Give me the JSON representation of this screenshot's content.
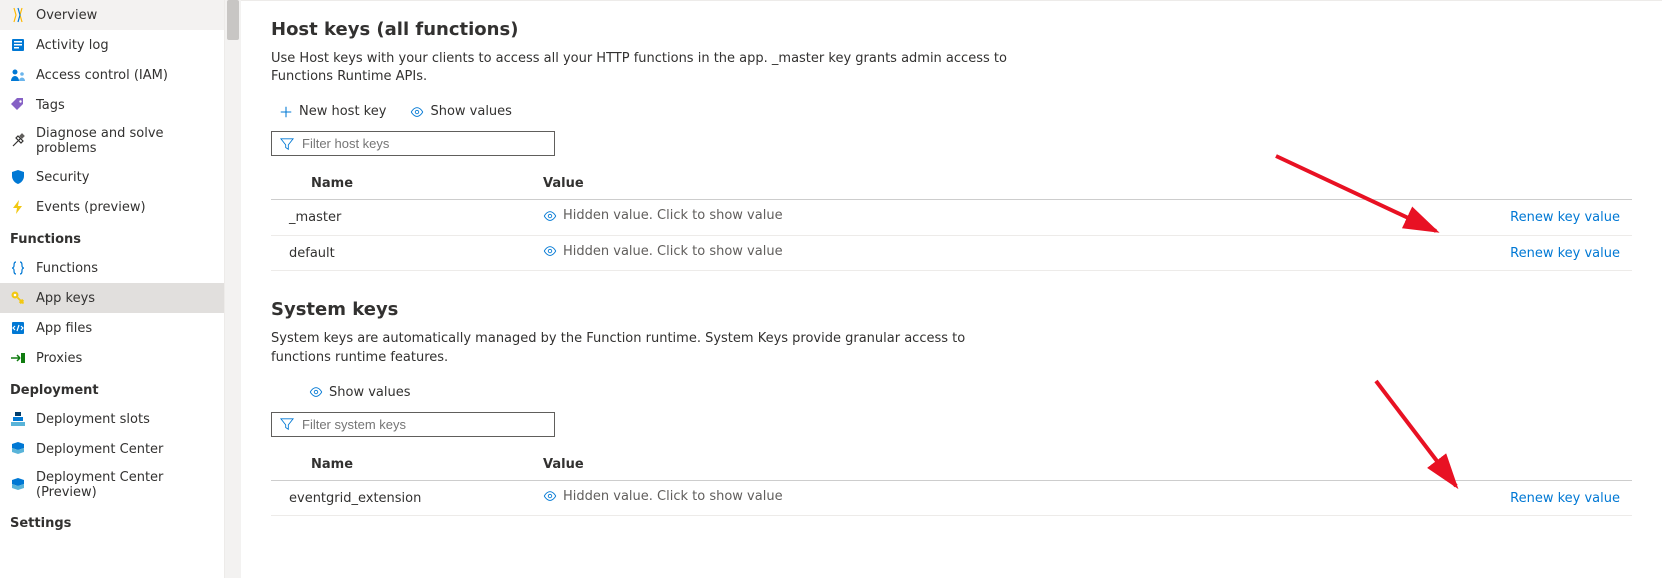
{
  "sidebar": {
    "topItems": [
      {
        "label": "Overview",
        "icon": "overview-icon",
        "color": "#0078d4"
      },
      {
        "label": "Activity log",
        "icon": "activity-log-icon",
        "color": "#0078d4"
      },
      {
        "label": "Access control (IAM)",
        "icon": "access-control-icon",
        "color": "#0078d4"
      },
      {
        "label": "Tags",
        "icon": "tags-icon",
        "color": "#6a2fc7"
      },
      {
        "label": "Diagnose and solve problems",
        "icon": "diagnose-icon",
        "color": "#323130"
      },
      {
        "label": "Security",
        "icon": "security-icon",
        "color": "#0078d4"
      },
      {
        "label": "Events (preview)",
        "icon": "events-icon",
        "color": "#f2c811"
      }
    ],
    "sections": [
      {
        "title": "Functions",
        "items": [
          {
            "label": "Functions",
            "icon": "functions-icon",
            "color": "#0078d4"
          },
          {
            "label": "App keys",
            "icon": "app-keys-icon",
            "color": "#f2c811",
            "selected": true
          },
          {
            "label": "App files",
            "icon": "app-files-icon",
            "color": "#0078d4"
          },
          {
            "label": "Proxies",
            "icon": "proxies-icon",
            "color": "#107c10"
          }
        ]
      },
      {
        "title": "Deployment",
        "items": [
          {
            "label": "Deployment slots",
            "icon": "deployment-slots-icon",
            "color": "#0078d4"
          },
          {
            "label": "Deployment Center",
            "icon": "deployment-center-icon",
            "color": "#0078d4"
          },
          {
            "label": "Deployment Center (Preview)",
            "icon": "deployment-center-icon",
            "color": "#0078d4"
          }
        ]
      },
      {
        "title": "Settings",
        "items": []
      }
    ]
  },
  "hostKeys": {
    "title": "Host keys (all functions)",
    "desc": "Use Host keys with your clients to access all your HTTP functions in the app. _master key grants admin access to Functions Runtime APIs.",
    "newBtn": "New host key",
    "showValuesBtn": "Show values",
    "filterPlaceholder": "Filter host keys",
    "cols": {
      "name": "Name",
      "value": "Value"
    },
    "hiddenText": "Hidden value. Click to show value",
    "renewText": "Renew key value",
    "rows": [
      {
        "name": "_master"
      },
      {
        "name": "default"
      }
    ]
  },
  "systemKeys": {
    "title": "System keys",
    "desc": "System keys are automatically managed by the Function runtime. System Keys provide granular access to functions runtime features.",
    "showValuesBtn": "Show values",
    "filterPlaceholder": "Filter system keys",
    "cols": {
      "name": "Name",
      "value": "Value"
    },
    "hiddenText": "Hidden value. Click to show value",
    "renewText": "Renew key value",
    "rows": [
      {
        "name": "eventgrid_extension"
      }
    ]
  }
}
